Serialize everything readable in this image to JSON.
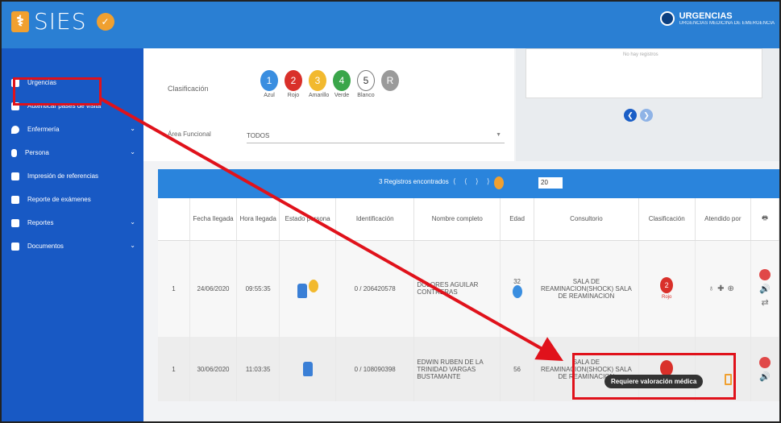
{
  "app": {
    "name": "SIES",
    "logo_glyph": "⚕",
    "badge_glyph": "✓"
  },
  "user": {
    "title": "URGENCIAS",
    "subtitle": "URGENCIAS MEDICINA DE EMERGENCIA"
  },
  "sidebar": {
    "items": [
      {
        "label": "Urgencias",
        "icon": "plus-square-icon",
        "chevron": ""
      },
      {
        "label": "Autenticar pases de visita",
        "icon": "badge-icon",
        "chevron": ""
      },
      {
        "label": "Enfermería",
        "icon": "location-pin-icon",
        "chevron": "⌄"
      },
      {
        "label": "Persona",
        "icon": "person-icon",
        "chevron": "⌄"
      },
      {
        "label": "Impresión de referencias",
        "icon": "printer-icon",
        "chevron": ""
      },
      {
        "label": "Reporte de exámenes",
        "icon": "document-icon",
        "chevron": ""
      },
      {
        "label": "Reportes",
        "icon": "copy-icon",
        "chevron": "⌄"
      },
      {
        "label": "Documentos",
        "icon": "folder-icon",
        "chevron": "⌄"
      }
    ]
  },
  "filters": {
    "clasificacion_label": "Clasificación",
    "levels": [
      {
        "num": "1",
        "name": "Azul",
        "color": "#3a8ee0"
      },
      {
        "num": "2",
        "name": "Rojo",
        "color": "#d9302a"
      },
      {
        "num": "3",
        "name": "Amarillo",
        "color": "#f2b92e"
      },
      {
        "num": "4",
        "name": "Verde",
        "color": "#3aa64a"
      },
      {
        "num": "5",
        "name": "Blanco",
        "color": "#ffffff"
      },
      {
        "num": "R",
        "name": "",
        "color": "#9a9a9a"
      }
    ],
    "area_label": "Área Funcional",
    "area_value": "TODOS"
  },
  "right_panel": {
    "note": "No hay registros"
  },
  "pager": {
    "count_text": "3 Registros encontrados",
    "nav": "⟨ ⟨   ⟩ ⟩",
    "page_size": "20"
  },
  "table": {
    "headers": [
      "",
      "Fecha llegada",
      "Hora llegada",
      "Estado persona",
      "Identificación",
      "Nombre completo",
      "Edad",
      "Consultorio",
      "Clasificación",
      "Atendido por",
      ""
    ],
    "rows": [
      {
        "num": "1",
        "fecha": "24/06/2020",
        "hora": "09:55:35",
        "id": "0 / 206420578",
        "nombre": "DOLORES AGUILAR CONTRERAS",
        "edad": "32",
        "consultorio": "SALA DE REAMINACION(SHOCK) SALA DE REAMINACION",
        "clas_num": "2",
        "clas_name": "Rojo"
      },
      {
        "num": "1",
        "fecha": "30/06/2020",
        "hora": "11:03:35",
        "id": "0 / 108090398",
        "nombre": "EDWIN RUBEN DE LA TRINIDAD VARGAS BUSTAMANTE",
        "edad": "56",
        "consultorio": "SALA DE REAMINACION(SHOCK) SALA DE REAMINACION",
        "clas_num": "",
        "clas_name": ""
      }
    ]
  },
  "tooltip": {
    "text": "Requiere valoración médica"
  },
  "colors": {
    "topbar": "#2a7fd3",
    "sidebar": "#1859c4",
    "highlight": "#e0121b"
  }
}
